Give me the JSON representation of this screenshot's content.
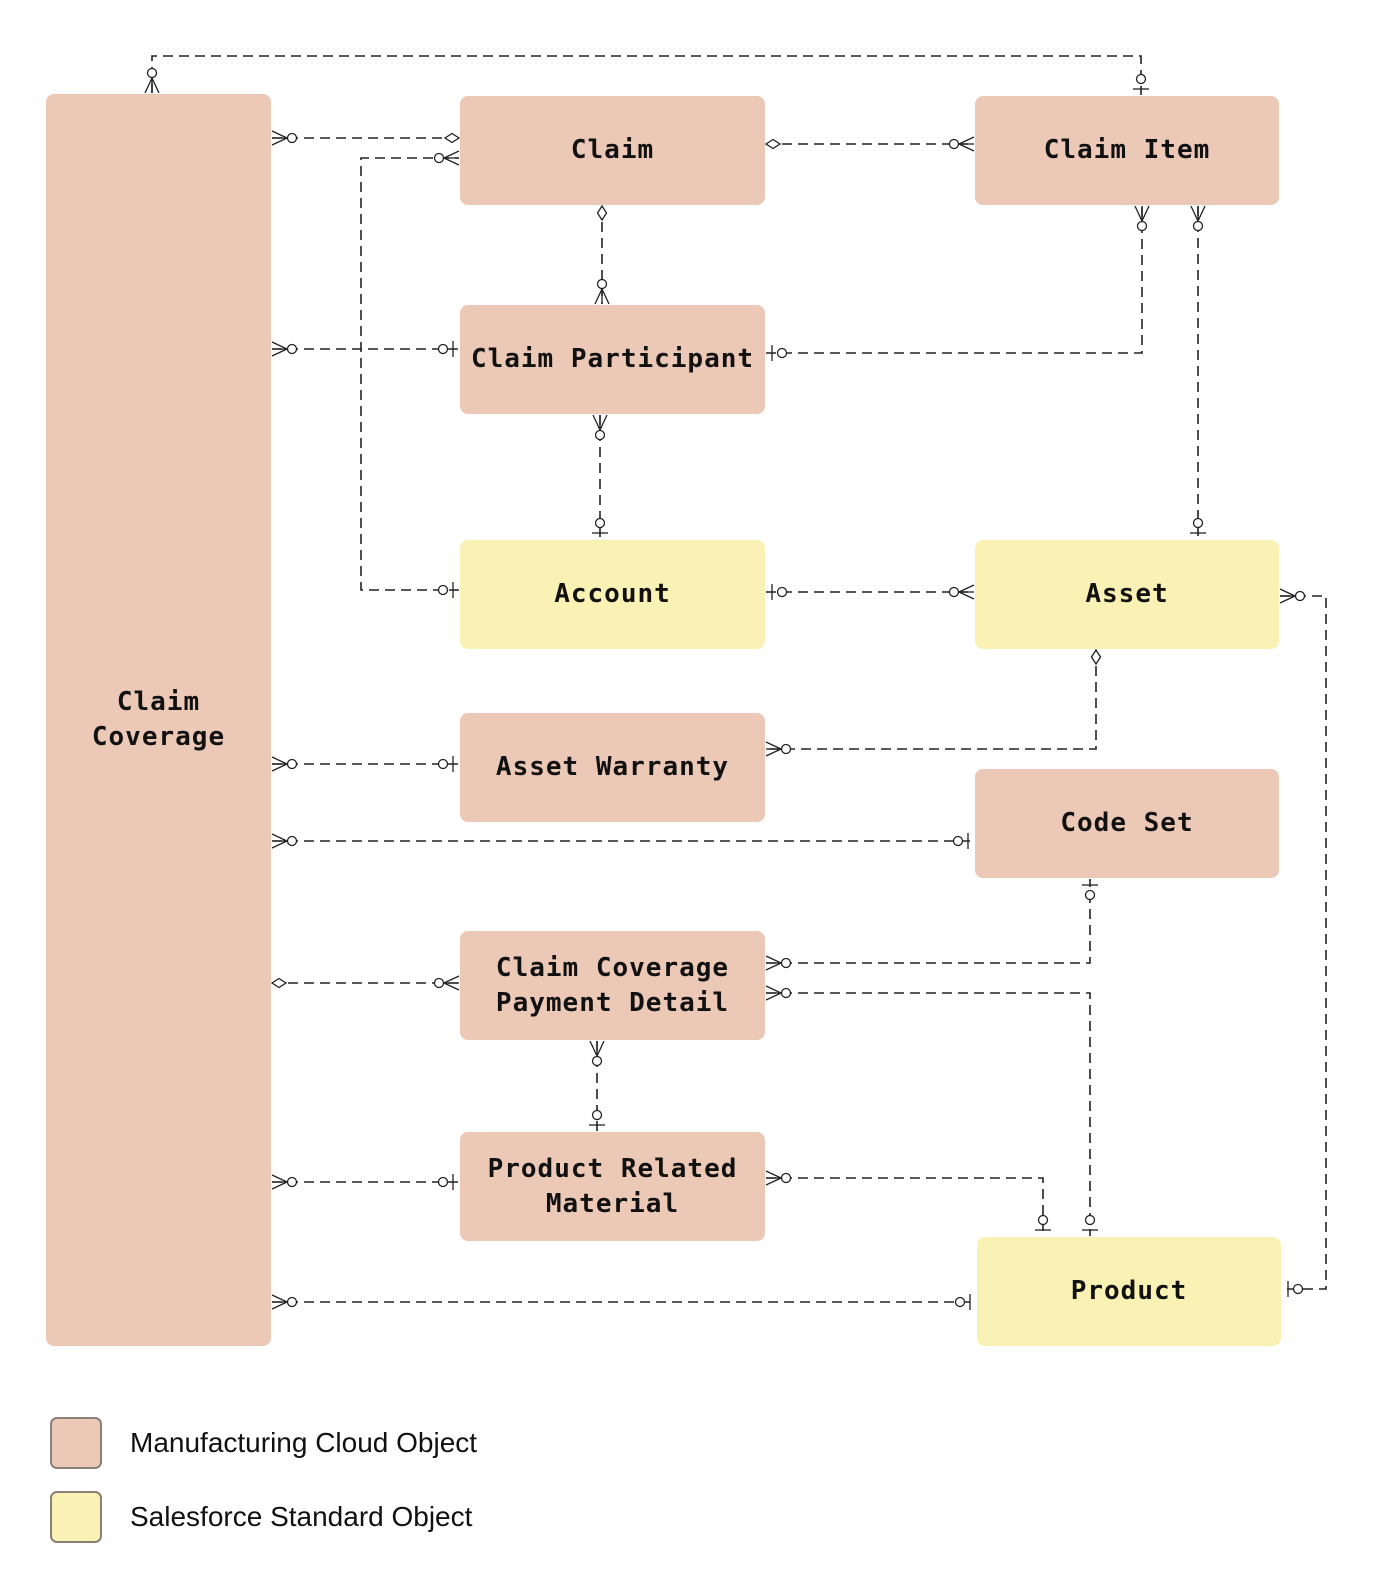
{
  "diagram": {
    "type": "entity-relationship",
    "entities": [
      {
        "id": "claim_coverage",
        "label": "Claim\nCoverage",
        "category": "manufacturing"
      },
      {
        "id": "claim",
        "label": "Claim",
        "category": "manufacturing"
      },
      {
        "id": "claim_item",
        "label": "Claim Item",
        "category": "manufacturing"
      },
      {
        "id": "claim_participant",
        "label": "Claim Participant",
        "category": "manufacturing"
      },
      {
        "id": "account",
        "label": "Account",
        "category": "standard"
      },
      {
        "id": "asset",
        "label": "Asset",
        "category": "standard"
      },
      {
        "id": "asset_warranty",
        "label": "Asset Warranty",
        "category": "manufacturing"
      },
      {
        "id": "code_set",
        "label": "Code Set",
        "category": "manufacturing"
      },
      {
        "id": "claim_coverage_payment_detail",
        "label": "Claim Coverage\nPayment Detail",
        "category": "manufacturing"
      },
      {
        "id": "product_related_material",
        "label": "Product Related\nMaterial",
        "category": "manufacturing"
      },
      {
        "id": "product",
        "label": "Product",
        "category": "standard"
      }
    ],
    "relationships": [
      {
        "from": "claim_coverage",
        "from_end": "zero-or-many",
        "to": "claim_item",
        "to_end": "zero-or-one"
      },
      {
        "from": "claim_coverage",
        "from_end": "zero-or-many",
        "to": "claim",
        "to_end": "aggregation"
      },
      {
        "from": "account",
        "from_end": "zero-or-one",
        "to": "claim",
        "to_end": "zero-or-many"
      },
      {
        "from": "claim",
        "from_end": "aggregation",
        "to": "claim_item",
        "to_end": "zero-or-many"
      },
      {
        "from": "claim",
        "from_end": "aggregation",
        "to": "claim_participant",
        "to_end": "zero-or-many"
      },
      {
        "from": "claim_coverage",
        "from_end": "zero-or-many",
        "to": "claim_participant",
        "to_end": "zero-or-one"
      },
      {
        "from": "claim_participant",
        "from_end": "zero-or-one",
        "to": "claim_item",
        "to_end": "zero-or-many"
      },
      {
        "from": "claim_participant",
        "from_end": "zero-or-many",
        "to": "account",
        "to_end": "zero-or-one"
      },
      {
        "from": "claim_item",
        "from_end": "zero-or-many",
        "to": "asset",
        "to_end": "zero-or-one"
      },
      {
        "from": "account",
        "from_end": "zero-or-one",
        "to": "asset",
        "to_end": "zero-or-many"
      },
      {
        "from": "asset",
        "from_end": "aggregation",
        "to": "asset_warranty",
        "to_end": "zero-or-many"
      },
      {
        "from": "asset",
        "from_end": "zero-or-many",
        "to": "product",
        "to_end": "zero-or-one"
      },
      {
        "from": "claim_coverage",
        "from_end": "zero-or-many",
        "to": "asset_warranty",
        "to_end": "zero-or-one"
      },
      {
        "from": "claim_coverage",
        "from_end": "zero-or-many",
        "to": "code_set",
        "to_end": "zero-or-one"
      },
      {
        "from": "claim_coverage",
        "from_end": "aggregation",
        "to": "claim_coverage_payment_detail",
        "to_end": "zero-or-many"
      },
      {
        "from": "claim_coverage_payment_detail",
        "from_end": "zero-or-many",
        "to": "code_set",
        "to_end": "zero-or-one"
      },
      {
        "from": "claim_coverage_payment_detail",
        "from_end": "zero-or-many",
        "to": "product",
        "to_end": "zero-or-one"
      },
      {
        "from": "claim_coverage_payment_detail",
        "from_end": "zero-or-many",
        "to": "product_related_material",
        "to_end": "zero-or-one"
      },
      {
        "from": "claim_coverage",
        "from_end": "zero-or-many",
        "to": "product_related_material",
        "to_end": "zero-or-one"
      },
      {
        "from": "product_related_material",
        "from_end": "zero-or-many",
        "to": "product",
        "to_end": "zero-or-one"
      },
      {
        "from": "claim_coverage",
        "from_end": "zero-or-many",
        "to": "product",
        "to_end": "zero-or-one"
      }
    ]
  },
  "colors": {
    "manufacturing": "#ecc8b6",
    "standard": "#faf2b5",
    "line": "#222222"
  },
  "legend": [
    {
      "label": "Manufacturing Cloud Object",
      "color": "#ecc8b6"
    },
    {
      "label": "Salesforce Standard Object",
      "color": "#faf2b5"
    }
  ]
}
